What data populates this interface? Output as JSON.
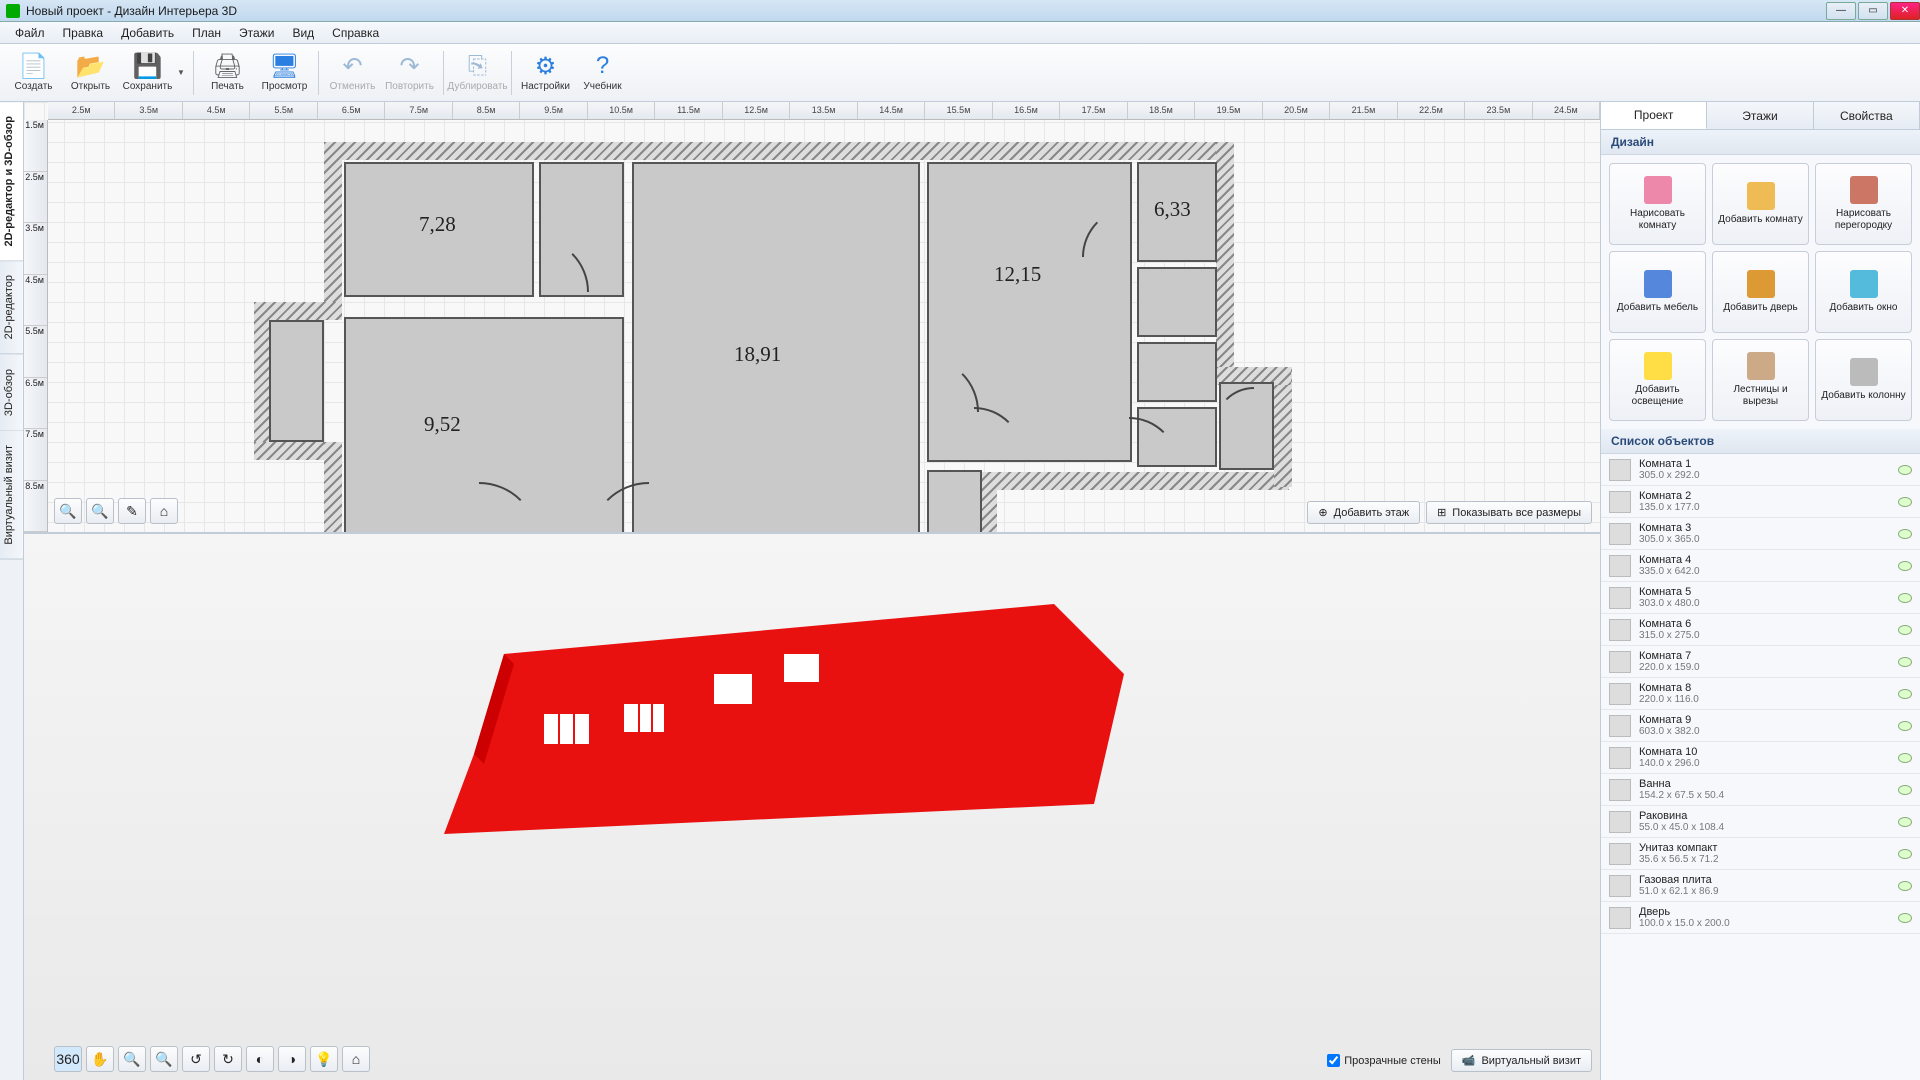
{
  "window": {
    "title": "Новый проект - Дизайн Интерьера 3D"
  },
  "menu": [
    "Файл",
    "Правка",
    "Добавить",
    "План",
    "Этажи",
    "Вид",
    "Справка"
  ],
  "toolbar": [
    {
      "id": "create",
      "label": "Создать",
      "color": "#fff",
      "icon": "📄"
    },
    {
      "id": "open",
      "label": "Открыть",
      "color": "#f5c06a",
      "icon": "📂"
    },
    {
      "id": "save",
      "label": "Сохранить",
      "color": "#3a6cd6",
      "icon": "💾",
      "dropdown": true
    },
    {
      "sep": true
    },
    {
      "id": "print",
      "label": "Печать",
      "color": "#666",
      "icon": "🖨"
    },
    {
      "id": "preview",
      "label": "Просмотр",
      "color": "#2a7fe0",
      "icon": "🖥"
    },
    {
      "sep": true
    },
    {
      "id": "undo",
      "label": "Отменить",
      "color": "#9db9d6",
      "icon": "↶",
      "disabled": true
    },
    {
      "id": "redo",
      "label": "Повторить",
      "color": "#9db9d6",
      "icon": "↷",
      "disabled": true
    },
    {
      "sep": true
    },
    {
      "id": "dup",
      "label": "Дублировать",
      "color": "#9db9d6",
      "icon": "⎘",
      "disabled": true
    },
    {
      "sep": true
    },
    {
      "id": "settings",
      "label": "Настройки",
      "color": "#2a7fe0",
      "icon": "⚙"
    },
    {
      "id": "tutorial",
      "label": "Учебник",
      "color": "#2a7fe0",
      "icon": "?"
    }
  ],
  "vtabs": [
    "2D-редактор и 3D-обзор",
    "2D-редактор",
    "3D-обзор",
    "Виртуальный визит"
  ],
  "ruler_h": [
    "2.5м",
    "3.5м",
    "4.5м",
    "5.5м",
    "6.5м",
    "7.5м",
    "8.5м",
    "9.5м",
    "10.5м",
    "11.5м",
    "12.5м",
    "13.5м",
    "14.5м",
    "15.5м",
    "16.5м",
    "17.5м",
    "18.5м",
    "19.5м",
    "20.5м",
    "21.5м",
    "22.5м",
    "23.5м",
    "24.5м"
  ],
  "ruler_v": [
    "1.5м",
    "2.5м",
    "3.5м",
    "4.5м",
    "5.5м",
    "6.5м",
    "7.5м",
    "8.5м"
  ],
  "rooms_labels": {
    "r1": "7,28",
    "r2": "18,91",
    "r3": "12,15",
    "r4": "6,33",
    "r5": "9,52"
  },
  "canvas_buttons": {
    "add_floor": "Добавить этаж",
    "show_sizes": "Показывать все размеры",
    "transparent_walls": "Прозрачные стены",
    "virtual_visit": "Виртуальный визит"
  },
  "rtabs": [
    "Проект",
    "Этажи",
    "Свойства"
  ],
  "sections": {
    "design": "Дизайн",
    "objects": "Список объектов"
  },
  "design_buttons": [
    {
      "label": "Нарисовать комнату",
      "color": "#e8a"
    },
    {
      "label": "Добавить комнату",
      "color": "#eb5"
    },
    {
      "label": "Нарисовать перегородку",
      "color": "#c76"
    },
    {
      "label": "Добавить мебель",
      "color": "#58d"
    },
    {
      "label": "Добавить дверь",
      "color": "#d93"
    },
    {
      "label": "Добавить окно",
      "color": "#5bd"
    },
    {
      "label": "Добавить освещение",
      "color": "#fd4"
    },
    {
      "label": "Лестницы и вырезы",
      "color": "#ca8"
    },
    {
      "label": "Добавить колонну",
      "color": "#bbb"
    }
  ],
  "objects": [
    {
      "name": "Комната 1",
      "dim": "305.0 x 292.0"
    },
    {
      "name": "Комната 2",
      "dim": "135.0 x 177.0"
    },
    {
      "name": "Комната 3",
      "dim": "305.0 x 365.0"
    },
    {
      "name": "Комната 4",
      "dim": "335.0 x 642.0"
    },
    {
      "name": "Комната 5",
      "dim": "303.0 x 480.0"
    },
    {
      "name": "Комната 6",
      "dim": "315.0 x 275.0"
    },
    {
      "name": "Комната 7",
      "dim": "220.0 x 159.0"
    },
    {
      "name": "Комната 8",
      "dim": "220.0 x 116.0"
    },
    {
      "name": "Комната 9",
      "dim": "603.0 x 382.0"
    },
    {
      "name": "Комната 10",
      "dim": "140.0 x 296.0"
    },
    {
      "name": "Ванна",
      "dim": "154.2 x 67.5 x 50.4"
    },
    {
      "name": "Раковина",
      "dim": "55.0 x 45.0 x 108.4"
    },
    {
      "name": "Унитаз компакт",
      "dim": "35.6 x 56.5 x 71.2"
    },
    {
      "name": "Газовая плита",
      "dim": "51.0 x 62.1 x 86.9"
    },
    {
      "name": "Дверь",
      "dim": "100.0 x 15.0 x 200.0"
    }
  ]
}
